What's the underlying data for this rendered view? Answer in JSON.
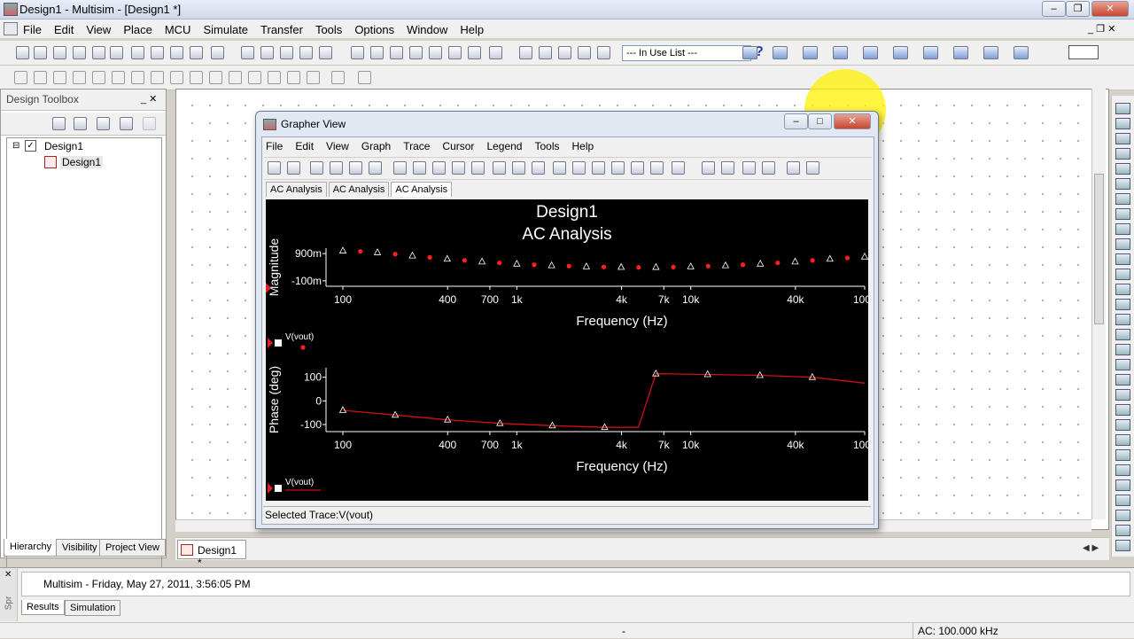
{
  "window": {
    "title": "Design1 - Multisim - [Design1 *]"
  },
  "menubar": [
    "File",
    "Edit",
    "View",
    "Place",
    "MCU",
    "Simulate",
    "Transfer",
    "Tools",
    "Options",
    "Window",
    "Help"
  ],
  "toolbar": {
    "in_use_list": "--- In Use List ---"
  },
  "toolbox": {
    "title": "Design Toolbox",
    "tree": {
      "root": "Design1",
      "child": "Design1"
    },
    "tabs": [
      "Hierarchy",
      "Visibility",
      "Project View"
    ]
  },
  "document_tab": "Design1 *",
  "spreadsheet": {
    "message": "Multisim  -  Friday, May 27, 2011, 3:56:05 PM",
    "tabs": [
      "Results",
      "Simulation"
    ],
    "side_label": "Spr"
  },
  "statusbar": {
    "middle": "-",
    "right": "AC: 100.000 kHz"
  },
  "grapher": {
    "title": "Grapher View",
    "menu": [
      "File",
      "Edit",
      "View",
      "Graph",
      "Trace",
      "Cursor",
      "Legend",
      "Tools",
      "Help"
    ],
    "tabs": [
      "AC Analysis",
      "AC Analysis",
      "AC Analysis"
    ],
    "status": "Selected Trace:V(vout)"
  },
  "chart_data": [
    {
      "type": "scatter",
      "title": "Design1",
      "subtitle": "AC Analysis",
      "xlabel": "Frequency (Hz)",
      "ylabel": "Magnitude",
      "x_scale": "log",
      "xlim": [
        80,
        100000
      ],
      "ylim": [
        -300,
        1100
      ],
      "x_ticks": [
        100,
        400,
        700,
        1000,
        4000,
        7000,
        10000,
        40000,
        100000
      ],
      "x_tick_labels": [
        "100",
        "400",
        "700",
        "1k",
        "4k",
        "7k",
        "10k",
        "40k",
        "100k"
      ],
      "y_ticks": [
        900,
        -100
      ],
      "y_tick_labels": [
        "900m",
        "-100m"
      ],
      "series": [
        {
          "name": "V(vout)",
          "color": "#ff2020",
          "marker": "dot",
          "x": [
            100,
            126,
            158,
            200,
            251,
            316,
            398,
            501,
            631,
            794,
            1000,
            1259,
            1585,
            1995,
            2512,
            3162,
            3981,
            5012,
            6310,
            7943,
            10000,
            12589,
            15849,
            19953,
            25119,
            31623,
            39811,
            50119,
            63096,
            79433,
            100000
          ],
          "y": [
            1000,
            980,
            940,
            880,
            820,
            760,
            700,
            650,
            600,
            560,
            520,
            490,
            460,
            440,
            420,
            410,
            400,
            395,
            398,
            405,
            420,
            440,
            460,
            490,
            520,
            560,
            600,
            650,
            700,
            740,
            780
          ]
        }
      ],
      "legend": "bottom-left",
      "grid": false
    },
    {
      "type": "line",
      "xlabel": "Frequency (Hz)",
      "ylabel": "Phase (deg)",
      "x_scale": "log",
      "xlim": [
        80,
        100000
      ],
      "ylim": [
        -130,
        140
      ],
      "x_ticks": [
        100,
        400,
        700,
        1000,
        4000,
        7000,
        10000,
        40000,
        100000
      ],
      "x_tick_labels": [
        "100",
        "400",
        "700",
        "1k",
        "4k",
        "7k",
        "10k",
        "40k",
        "100k"
      ],
      "y_ticks": [
        100,
        0,
        -100
      ],
      "y_tick_labels": [
        "100",
        "0",
        "-100"
      ],
      "series": [
        {
          "name": "V(vout)",
          "color": "#d01010",
          "x": [
            100,
            200,
            400,
            800,
            1600,
            3200,
            5000,
            6300,
            12500,
            25000,
            50000,
            100000
          ],
          "y": [
            -40,
            -60,
            -80,
            -95,
            -105,
            -112,
            -112,
            115,
            112,
            108,
            100,
            75
          ]
        }
      ],
      "legend": "bottom-left",
      "grid": false
    }
  ]
}
